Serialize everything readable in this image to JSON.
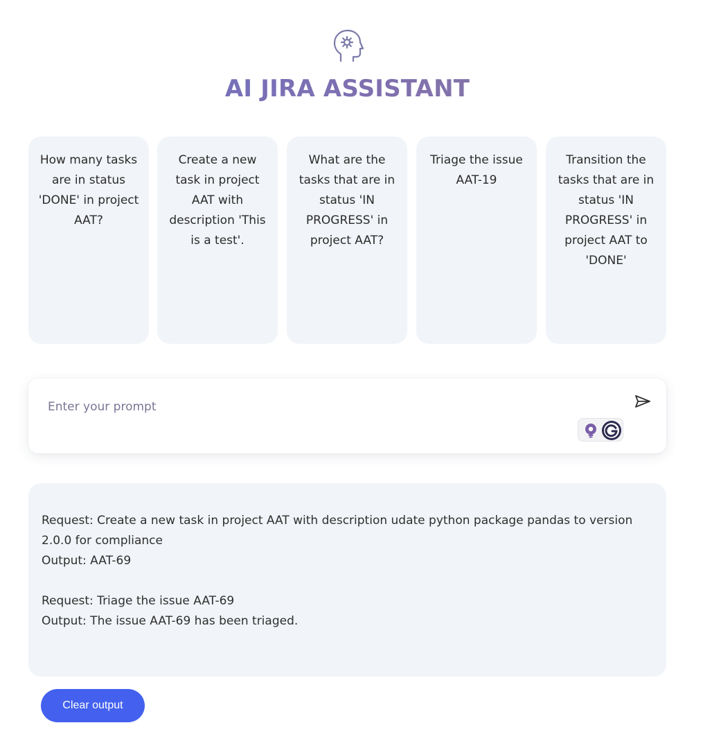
{
  "header": {
    "icon": "brain-gear-icon",
    "title": "AI JIRA ASSISTANT"
  },
  "suggestions": [
    {
      "label": "How many tasks are in status 'DONE' in project AAT?"
    },
    {
      "label": "Create a new task in project AAT with description 'This is a test'."
    },
    {
      "label": "What are the tasks that are in status 'IN PROGRESS' in project AAT?"
    },
    {
      "label": "Triage the issue AAT-19"
    },
    {
      "label": "Transition the tasks that are in status 'IN PROGRESS' in project AAT to 'DONE'"
    }
  ],
  "prompt": {
    "placeholder": "Enter your prompt",
    "value": "",
    "send_icon": "send-icon",
    "extension_icons": [
      "bulb-icon",
      "grammarly-icon"
    ]
  },
  "output": {
    "lines": [
      "Request: Create a new task in project AAT with description udate python package pandas to version 2.0.0 for compliance",
      "Output: AAT-69",
      "",
      "Request: Triage the issue AAT-69",
      "Output: The issue AAT-69 has been triaged."
    ]
  },
  "actions": {
    "clear_label": "Clear output"
  },
  "colors": {
    "accent": "#4361ee",
    "title_gradient_start": "#6b72c9",
    "title_gradient_end": "#8f7f9f",
    "card_bg": "#f1f4f8"
  }
}
